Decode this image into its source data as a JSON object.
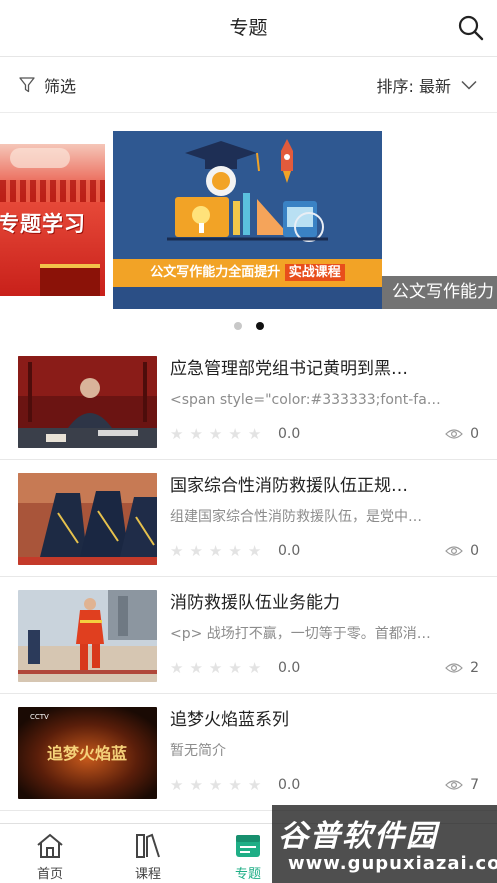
{
  "header": {
    "title": "专题"
  },
  "filterbar": {
    "filter_label": "筛选",
    "sort_label": "排序: 最新"
  },
  "carousel": {
    "left_slide_text": "专题学习",
    "main_banner_text": "公文写作能力全面提升",
    "main_banner_highlight": "实战课程",
    "caption": "公文写作能力",
    "active_index": 1,
    "slide_count": 2
  },
  "items": [
    {
      "title": "应急管理部党组书记黄明到黑…",
      "desc": "<span style=\"color:#333333;font-fa…",
      "score": "0.0",
      "views": "0"
    },
    {
      "title": "国家综合性消防救援队伍正规…",
      "desc": "组建国家综合性消防救援队伍，是党中…",
      "score": "0.0",
      "views": "0"
    },
    {
      "title": "消防救援队伍业务能力",
      "desc": "<p> 战场打不赢，一切等于零。首都消…",
      "score": "0.0",
      "views": "2"
    },
    {
      "title": "追梦火焰蓝系列",
      "desc": "暂无简介",
      "score": "0.0",
      "views": "7"
    }
  ],
  "thumb4_text": "追梦火焰蓝",
  "tabs": [
    {
      "label": "首页",
      "icon": "home-icon"
    },
    {
      "label": "课程",
      "icon": "course-icon"
    },
    {
      "label": "专题",
      "icon": "topic-icon",
      "active": true
    }
  ],
  "colors": {
    "accent": "#1fae86",
    "banner_blue": "#2f5891",
    "banner_orange": "#f2a326"
  },
  "watermark": {
    "brand": "谷普软件园",
    "url": "www.gupuxiazai.com"
  }
}
